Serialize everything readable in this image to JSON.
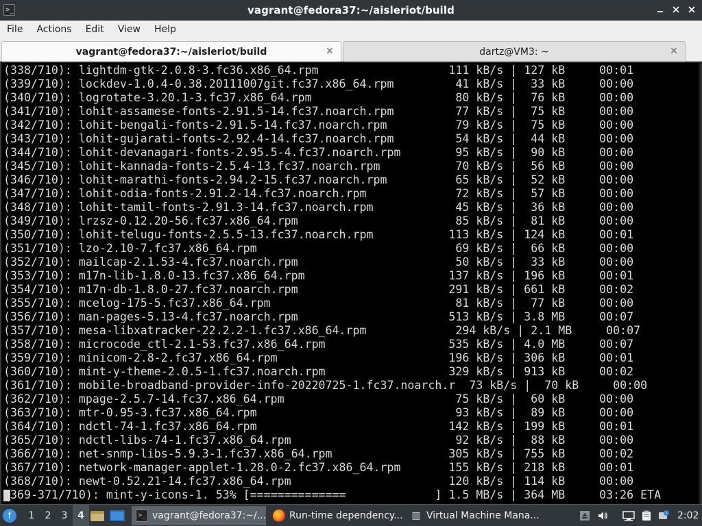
{
  "window": {
    "title": "vagrant@fedora37:~/aisleriot/build",
    "app_icon": "terminal-icon"
  },
  "menu": [
    "File",
    "Actions",
    "Edit",
    "View",
    "Help"
  ],
  "tabs": [
    {
      "label": "vagrant@fedora37:~/aisleriot/build",
      "active": true
    },
    {
      "label": "dartz@VM3: ~",
      "active": false
    }
  ],
  "terminal": {
    "lines": [
      "(338/710): lightdm-gtk-2.0.8-3.fc36.x86_64.rpm                   111 kB/s | 127 kB     00:01",
      "(339/710): lockdev-1.0.4-0.38.20111007git.fc37.x86_64.rpm         41 kB/s |  33 kB     00:00",
      "(340/710): logrotate-3.20.1-3.fc37.x86_64.rpm                     80 kB/s |  76 kB     00:00",
      "(341/710): lohit-assamese-fonts-2.91.5-14.fc37.noarch.rpm         77 kB/s |  75 kB     00:00",
      "(342/710): lohit-bengali-fonts-2.91.5-14.fc37.noarch.rpm          79 kB/s |  75 kB     00:00",
      "(343/710): lohit-gujarati-fonts-2.92.4-14.fc37.noarch.rpm         54 kB/s |  44 kB     00:00",
      "(344/710): lohit-devanagari-fonts-2.95.5-4.fc37.noarch.rpm        95 kB/s |  90 kB     00:00",
      "(345/710): lohit-kannada-fonts-2.5.4-13.fc37.noarch.rpm           70 kB/s |  56 kB     00:00",
      "(346/710): lohit-marathi-fonts-2.94.2-15.fc37.noarch.rpm          65 kB/s |  52 kB     00:00",
      "(347/710): lohit-odia-fonts-2.91.2-14.fc37.noarch.rpm             72 kB/s |  57 kB     00:00",
      "(348/710): lohit-tamil-fonts-2.91.3-14.fc37.noarch.rpm            45 kB/s |  36 kB     00:00",
      "(349/710): lrzsz-0.12.20-56.fc37.x86_64.rpm                       85 kB/s |  81 kB     00:00",
      "(350/710): lohit-telugu-fonts-2.5.5-13.fc37.noarch.rpm           113 kB/s | 124 kB     00:01",
      "(351/710): lzo-2.10-7.fc37.x86_64.rpm                             69 kB/s |  66 kB     00:00",
      "(352/710): mailcap-2.1.53-4.fc37.noarch.rpm                       50 kB/s |  33 kB     00:00",
      "(353/710): m17n-lib-1.8.0-13.fc37.x86_64.rpm                     137 kB/s | 196 kB     00:01",
      "(354/710): m17n-db-1.8.0-27.fc37.noarch.rpm                      291 kB/s | 661 kB     00:02",
      "(355/710): mcelog-175-5.fc37.x86_64.rpm                           81 kB/s |  77 kB     00:00",
      "(356/710): man-pages-5.13-4.fc37.noarch.rpm                      513 kB/s | 3.8 MB     00:07",
      "(357/710): mesa-libxatracker-22.2.2-1.fc37.x86_64.rpm             294 kB/s | 2.1 MB     00:07",
      "(358/710): microcode_ctl-2.1-53.fc37.x86_64.rpm                  535 kB/s | 4.0 MB     00:07",
      "(359/710): minicom-2.8-2.fc37.x86_64.rpm                         196 kB/s | 306 kB     00:01",
      "(360/710): mint-y-theme-2.0.5-1.fc37.noarch.rpm                  329 kB/s | 913 kB     00:02",
      "(361/710): mobile-broadband-provider-info-20220725-1.fc37.noarch.r  73 kB/s |  70 kB     00:00",
      "(362/710): mpage-2.5.7-14.fc37.x86_64.rpm                         75 kB/s |  60 kB     00:00",
      "(363/710): mtr-0.95-3.fc37.x86_64.rpm                             93 kB/s |  89 kB     00:00",
      "(364/710): ndctl-74-1.fc37.x86_64.rpm                            142 kB/s | 199 kB     00:01",
      "(365/710): ndctl-libs-74-1.fc37.x86_64.rpm                        92 kB/s |  88 kB     00:00",
      "(366/710): net-snmp-libs-5.9.3-1.fc37.x86_64.rpm                 305 kB/s | 755 kB     00:02",
      "(367/710): network-manager-applet-1.28.0-2.fc37.x86_64.rpm       155 kB/s | 218 kB     00:01",
      "(368/710): newt-0.52.21-14.fc37.x86_64.rpm                       120 kB/s | 114 kB     00:00"
    ],
    "progress_line": "(369-371/710): mint-y-icons-1. 53% [==============             ] 1.5 MB/s | 364 MB     03:26 ETA"
  },
  "taskbar": {
    "start_icon": "fedora-logo-icon",
    "workspaces": [
      "1",
      "2",
      "3",
      "4"
    ],
    "active_workspace": "4",
    "tasks": [
      {
        "label": "vagrant@fedora37:~/...",
        "icon": "terminal-icon",
        "active": true
      },
      {
        "label": "Run-time dependency...",
        "icon": "firefox-icon",
        "active": false
      },
      {
        "label": "Virtual Machine Mana...",
        "icon": "virt-manager-icon",
        "active": false
      }
    ],
    "clock": "2:02"
  },
  "colors": {
    "titlebar": "#31363b",
    "menubar": "#efefef",
    "terminal_bg": "#000000",
    "terminal_fg": "#d8d8d8",
    "taskbar": "#31363b"
  }
}
